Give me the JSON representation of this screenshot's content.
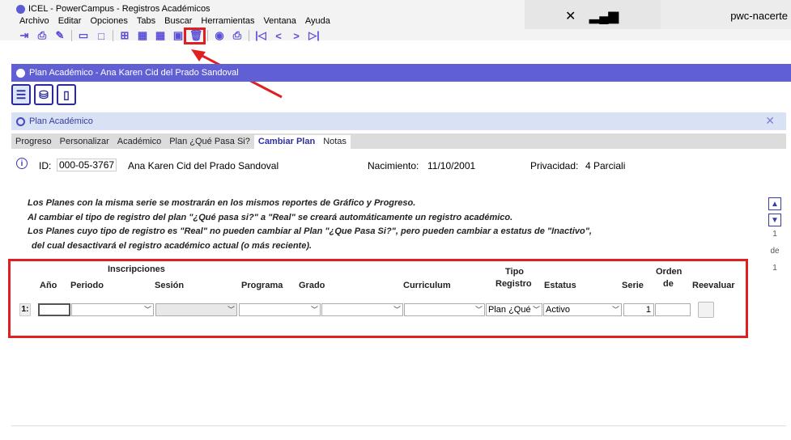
{
  "window": {
    "title": "ICEL - PowerCampus - Registros Académicos"
  },
  "menu": [
    "Archivo",
    "Editar",
    "Opciones",
    "Tabs",
    "Buscar",
    "Herramientas",
    "Ventana",
    "Ayuda"
  ],
  "toolbar_icons": [
    "exit-icon",
    "print-icon",
    "edit-icon",
    "open-icon",
    "folder-icon",
    "new-icon",
    "grid-icon",
    "grid2-icon",
    "save-icon",
    "delete-icon",
    "view-icon",
    "print2-icon",
    "first-icon",
    "prev-icon",
    "next-icon",
    "last-icon"
  ],
  "system": {
    "user": "pwc-nacerte"
  },
  "plan_bar": {
    "title": "Plan Académico -  Ana Karen Cid del Prado Sandoval"
  },
  "subheader": {
    "title": "Plan Académico"
  },
  "tabs": [
    "Progreso",
    "Personalizar",
    "Académico",
    "Plan ¿Qué Pasa Si?",
    "Cambiar Plan",
    "Notas"
  ],
  "active_tab": "Cambiar Plan",
  "student": {
    "id_label": "ID:",
    "id": "000-05-3767",
    "name": "Ana Karen Cid del Prado Sandoval",
    "birth_label": "Nacimiento:",
    "birth": "11/10/2001",
    "privacy_label": "Privacidad:",
    "privacy": "4 Parciali"
  },
  "notes": [
    "Los Planes con la misma serie se mostrarán en los mismos reportes de Gráfico y Progreso.",
    "Al cambiar el tipo de registro del plan \"¿Qué pasa si?\" a \"Real\" se creará automáticamente un registro académico.",
    "Los Planes cuyo tipo de registro es \"Real\" no pueden cambiar al Plan \"¿Que Pasa Si?\", pero pueden cambiar a estatus de \"Inactivo\",",
    "del cual desactivará el registro académico actual (o más reciente)."
  ],
  "pager": {
    "current": "1",
    "of_label": "de",
    "total": "1"
  },
  "grid": {
    "group_header": "Inscripciones",
    "headers": {
      "anio": "Año",
      "periodo": "Periodo",
      "sesion": "Sesión",
      "programa": "Programa",
      "grado": "Grado",
      "curriculum": "Curriculum",
      "tipo": "Tipo",
      "registro": "Registro",
      "estatus": "Estatus",
      "serie": "Serie",
      "orden": "Orden",
      "de": "de",
      "reevaluar": "Reevaluar"
    },
    "row": {
      "num": "1:",
      "anio": "",
      "periodo": "",
      "sesion": "",
      "programa": "",
      "grado": "",
      "curriculum": "",
      "tipo_registro": "Plan ¿Qué",
      "estatus": "Activo",
      "serie": "1",
      "orden": ""
    }
  },
  "colors": {
    "accent": "#6060d4",
    "highlight": "#e02020"
  }
}
